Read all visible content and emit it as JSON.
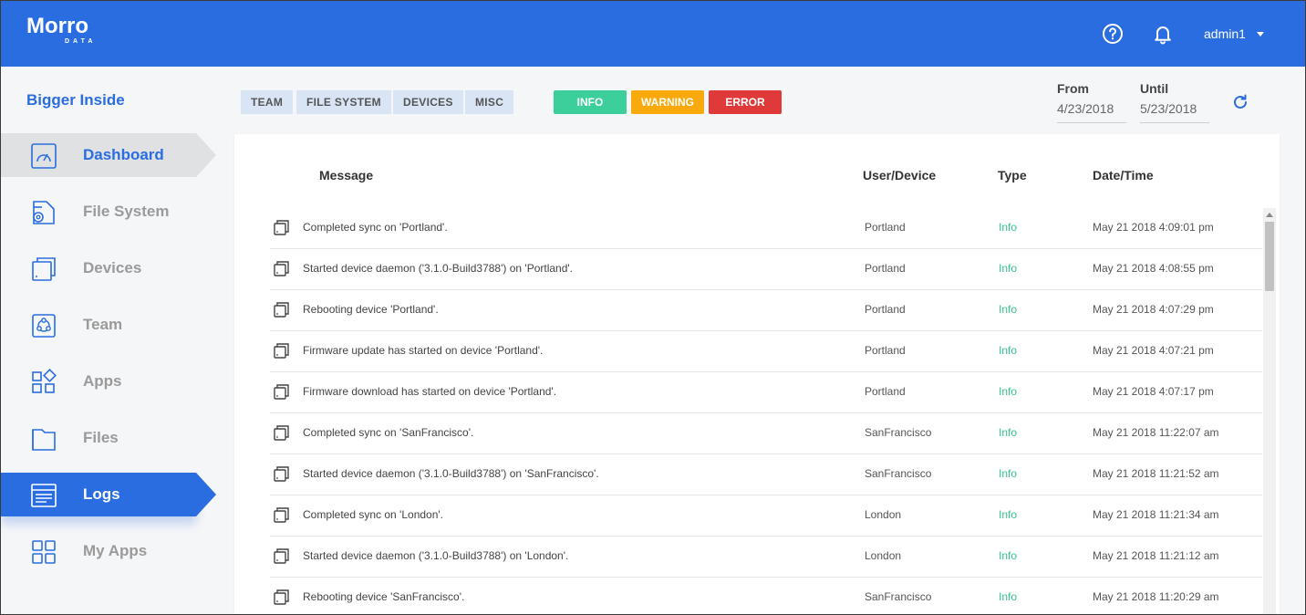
{
  "header": {
    "logo_main": "Morro",
    "logo_sub": "DATA",
    "user": "admin1",
    "icons": [
      "help-icon",
      "bell-icon",
      "chevron-down-icon"
    ]
  },
  "sidebar": {
    "org_name": "Bigger Inside",
    "items": [
      {
        "label": "Dashboard",
        "icon": "dashboard-gauge-icon"
      },
      {
        "label": "File System",
        "icon": "file-system-gear-icon"
      },
      {
        "label": "Devices",
        "icon": "device-icon"
      },
      {
        "label": "Team",
        "icon": "team-icon"
      },
      {
        "label": "Apps",
        "icon": "apps-icon"
      },
      {
        "label": "Files",
        "icon": "file-icon"
      },
      {
        "label": "Logs",
        "icon": "logs-icon"
      },
      {
        "label": "My Apps",
        "icon": "my-apps-grid-icon"
      }
    ]
  },
  "filters": {
    "categories": [
      "TEAM",
      "FILE SYSTEM",
      "DEVICES",
      "MISC"
    ],
    "levels": [
      {
        "label": "INFO",
        "color": "#3ccf9c"
      },
      {
        "label": "WARNING",
        "color": "#f9a90b"
      },
      {
        "label": "ERROR",
        "color": "#e03939"
      }
    ]
  },
  "date_range": {
    "from_label": "From",
    "from_value": "4/23/2018",
    "until_label": "Until",
    "until_value": "5/23/2018"
  },
  "table": {
    "headers": {
      "message": "Message",
      "user_device": "User/Device",
      "type": "Type",
      "datetime": "Date/Time"
    },
    "rows": [
      {
        "message": "Completed sync on 'Portland'.",
        "device": "Portland",
        "type": "Info",
        "datetime": "May 21 2018 4:09:01 pm"
      },
      {
        "message": "Started device daemon ('3.1.0-Build3788') on 'Portland'.",
        "device": "Portland",
        "type": "Info",
        "datetime": "May 21 2018 4:08:55 pm"
      },
      {
        "message": "Rebooting device 'Portland'.",
        "device": "Portland",
        "type": "Info",
        "datetime": "May 21 2018 4:07:29 pm"
      },
      {
        "message": "Firmware update has started on device 'Portland'.",
        "device": "Portland",
        "type": "Info",
        "datetime": "May 21 2018 4:07:21 pm"
      },
      {
        "message": "Firmware download has started on device 'Portland'.",
        "device": "Portland",
        "type": "Info",
        "datetime": "May 21 2018 4:07:17 pm"
      },
      {
        "message": "Completed sync on 'SanFrancisco'.",
        "device": "SanFrancisco",
        "type": "Info",
        "datetime": "May 21 2018 11:22:07 am"
      },
      {
        "message": "Started device daemon ('3.1.0-Build3788') on 'SanFrancisco'.",
        "device": "SanFrancisco",
        "type": "Info",
        "datetime": "May 21 2018 11:21:52 am"
      },
      {
        "message": "Completed sync on 'London'.",
        "device": "London",
        "type": "Info",
        "datetime": "May 21 2018 11:21:34 am"
      },
      {
        "message": "Started device daemon ('3.1.0-Build3788') on 'London'.",
        "device": "London",
        "type": "Info",
        "datetime": "May 21 2018 11:21:12 am"
      },
      {
        "message": "Rebooting device 'SanFrancisco'.",
        "device": "SanFrancisco",
        "type": "Info",
        "datetime": "May 21 2018 11:20:29 am"
      }
    ]
  },
  "colors": {
    "brand": "#2a6de0",
    "info": "#36c28c",
    "tag_bg": "#d9e4f5"
  }
}
